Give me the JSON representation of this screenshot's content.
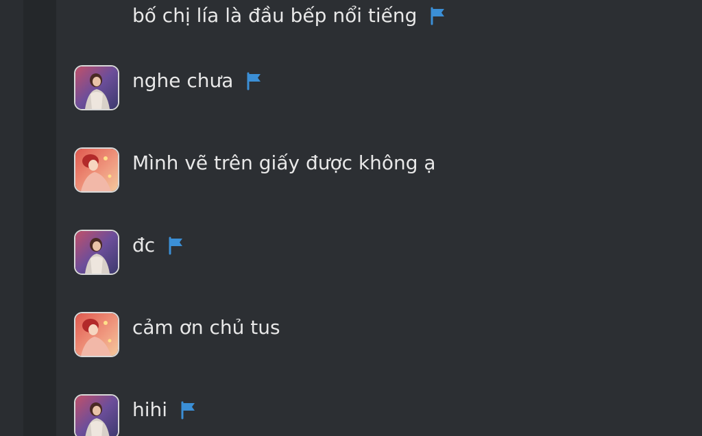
{
  "messages": [
    {
      "text": "bố chị lía là đầu bếp nổi tiếng",
      "avatar": "none",
      "flag_icon": "flag-icon",
      "flagged": true
    },
    {
      "text": "nghe chưa",
      "avatar": "avatar-girl-purple",
      "flag_icon": "flag-icon",
      "flagged": true
    },
    {
      "text": "Mình vẽ trên giấy được không ạ",
      "avatar": "avatar-girl-red",
      "flagged": false
    },
    {
      "text": "đc",
      "avatar": "avatar-girl-purple",
      "flag_icon": "flag-icon",
      "flagged": true
    },
    {
      "text": "cảm ơn chủ tus",
      "avatar": "avatar-girl-red",
      "flagged": false
    },
    {
      "text": "hihi",
      "avatar": "avatar-girl-purple",
      "flag_icon": "flag-icon",
      "flagged": true
    }
  ],
  "colors": {
    "background": "#2c2f33",
    "text": "#e8e8e8",
    "flag": "#3b8fd6",
    "avatar_border": "#d9d9d9"
  }
}
